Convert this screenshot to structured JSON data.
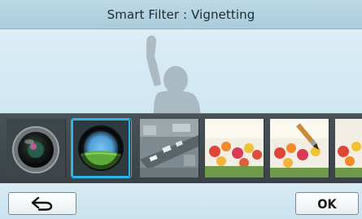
{
  "header": {
    "title": "Smart Filter : Vignetting"
  },
  "filters": [
    {
      "icon": "fisheye-lens-icon",
      "selected": false
    },
    {
      "icon": "vignetting-lens-icon",
      "selected": true
    },
    {
      "icon": "miniature-city-icon",
      "selected": false
    },
    {
      "icon": "sketch-flowers-icon",
      "selected": false
    },
    {
      "icon": "sketch-flowers-brush-icon",
      "selected": false
    },
    {
      "icon": "sketch-flowers-partial-icon",
      "selected": false
    }
  ],
  "footer": {
    "back_icon": "back-arrow-icon",
    "ok_label": "OK"
  },
  "colors": {
    "selection": "#2bb6e8",
    "filmstrip": "#3f484d",
    "title_bar": "#b3d2e0"
  }
}
